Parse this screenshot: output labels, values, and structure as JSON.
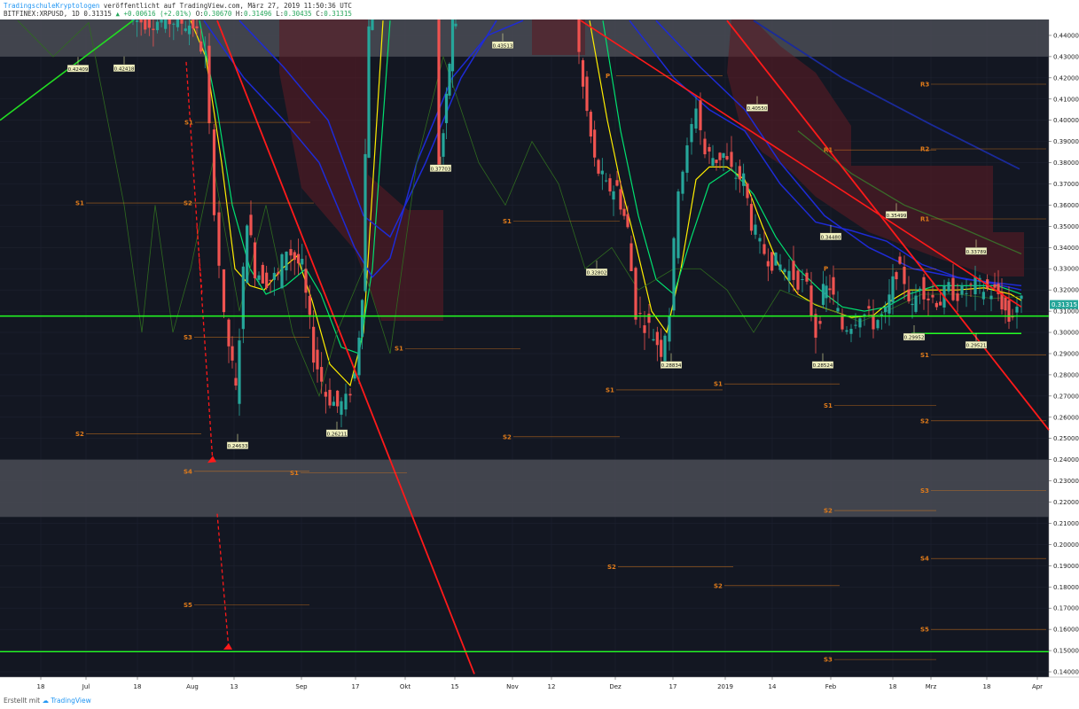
{
  "header": {
    "publisher": "TradingschuleKryptologen",
    "published_text": "veröffentlicht auf TradingView.com, März 27, 2019 11:50:36 UTC",
    "symbol": "BITFINEX:XRPUSD, 1D",
    "last": "0.31315",
    "up_arrow": "▲",
    "change": "+0.00616 (+2.01%)",
    "o_label": "O:",
    "o_value": "0.30670",
    "h_label": "H:",
    "h_value": "0.31496",
    "l_label": "L:",
    "l_value": "0.30435",
    "c_label": "C:",
    "c_value": "0.31315"
  },
  "footer": {
    "prefix": "Erstellt mit",
    "brand": "TradingView"
  },
  "colors": {
    "background": "#131722",
    "bull": "#26a69a",
    "bear": "#ef5350",
    "trendline": "#ff1a1a",
    "support_line": "#22ff22",
    "zone": "#4a4c55",
    "ema_yellow": "#ffee00",
    "ema_green": "#00e070",
    "ma_blue": "#1e2bd6",
    "pivot": "#e07b1a"
  },
  "chart_data": {
    "type": "candlestick",
    "symbol": "BITFINEX:XRPUSD",
    "timeframe": "1D",
    "ylim": [
      0.1375,
      0.4475
    ],
    "y_ticks": [
      "0.44000",
      "0.43000",
      "0.42000",
      "0.41000",
      "0.40000",
      "0.39000",
      "0.38000",
      "0.37000",
      "0.36000",
      "0.35000",
      "0.34000",
      "0.33000",
      "0.32000",
      "0.31000",
      "0.30000",
      "0.29000",
      "0.28000",
      "0.27000",
      "0.26000",
      "0.25000",
      "0.24000",
      "0.23000",
      "0.22000",
      "0.21000",
      "0.20000",
      "0.19000",
      "0.18000",
      "0.17000",
      "0.16000",
      "0.15000",
      "0.14000"
    ],
    "current_price_label": "0.31315",
    "x_ticks": [
      "18",
      "Jul",
      "18",
      "Aug",
      "13",
      "Sep",
      "17",
      "Okt",
      "15",
      "Nov",
      "12",
      "Dez",
      "17",
      "2019",
      "14",
      "Feb",
      "18",
      "Mrz",
      "18",
      "Apr"
    ],
    "zones": [
      {
        "from": 0.43,
        "to": 0.4475
      },
      {
        "from": 0.213,
        "to": 0.24
      }
    ],
    "horizontal_lines": [
      0.3077,
      0.1495
    ],
    "price_labels": [
      {
        "text": "0.42409",
        "price": 0.424
      },
      {
        "text": "0.42418",
        "price": 0.4242
      },
      {
        "text": "0.24633",
        "price": 0.2463
      },
      {
        "text": "0.26211",
        "price": 0.2521
      },
      {
        "text": "0.37703",
        "price": 0.377
      },
      {
        "text": "0.43513",
        "price": 0.4351
      },
      {
        "text": "0.32802",
        "price": 0.328
      },
      {
        "text": "0.28834",
        "price": 0.2843
      },
      {
        "text": "0.40550",
        "price": 0.4055
      },
      {
        "text": "0.34480",
        "price": 0.3448
      },
      {
        "text": "0.28524",
        "price": 0.2843
      },
      {
        "text": "0.35499",
        "price": 0.355
      },
      {
        "text": "0.29952",
        "price": 0.2975
      },
      {
        "text": "0.33789",
        "price": 0.3379
      },
      {
        "text": "0.29521",
        "price": 0.2937
      }
    ],
    "pivot_labels": [
      {
        "text": "S1",
        "price": 0.399
      },
      {
        "text": "S1",
        "price": 0.361
      },
      {
        "text": "S2",
        "price": 0.361
      },
      {
        "text": "S3",
        "price": 0.2978
      },
      {
        "text": "S2",
        "price": 0.2521
      },
      {
        "text": "S4",
        "price": 0.2345
      },
      {
        "text": "S1",
        "price": 0.2338
      },
      {
        "text": "S5",
        "price": 0.1715
      },
      {
        "text": "S1",
        "price": 0.2924
      },
      {
        "text": "S1",
        "price": 0.3524
      },
      {
        "text": "S2",
        "price": 0.2508
      },
      {
        "text": "P",
        "price": 0.421
      },
      {
        "text": "S1",
        "price": 0.2729
      },
      {
        "text": "S2",
        "price": 0.1806
      },
      {
        "text": "S1",
        "price": 0.2757
      },
      {
        "text": "S2",
        "price": 0.1895
      },
      {
        "text": "R1",
        "price": 0.386
      },
      {
        "text": "P",
        "price": 0.33
      },
      {
        "text": "S1",
        "price": 0.2656
      },
      {
        "text": "S2",
        "price": 0.216
      },
      {
        "text": "S3",
        "price": 0.1458
      },
      {
        "text": "R3",
        "price": 0.417
      },
      {
        "text": "R2",
        "price": 0.3865
      },
      {
        "text": "R1",
        "price": 0.3535
      },
      {
        "text": "S1",
        "price": 0.2893
      },
      {
        "text": "S2",
        "price": 0.2583
      },
      {
        "text": "S3",
        "price": 0.2255
      },
      {
        "text": "S4",
        "price": 0.1934
      },
      {
        "text": "S5",
        "price": 0.16
      }
    ]
  }
}
